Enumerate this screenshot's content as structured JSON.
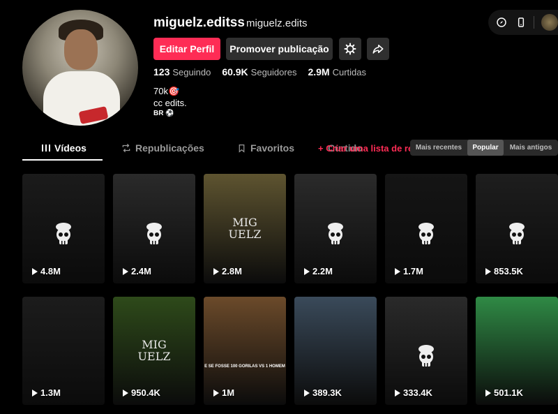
{
  "profile": {
    "username": "miguelz.editss",
    "nickname": "miguelz.edits",
    "edit_label": "Editar Perfil",
    "promote_label": "Promover publicação",
    "stats": [
      {
        "value": "123",
        "label": "Seguindo"
      },
      {
        "value": "60.9K",
        "label": "Seguidores"
      },
      {
        "value": "2.9M",
        "label": "Curtidas"
      }
    ],
    "bio_line1": "70k🎯",
    "bio_line2": "cc edits.",
    "bio_line3": "BR ⚽"
  },
  "tabs": {
    "videos": "Vídeos",
    "reposts": "Republicações",
    "favorites": "Favoritos",
    "liked": "Curtido",
    "create_playlist": "+ Criar uma lista de reprodução"
  },
  "sort": {
    "recent": "Mais recentes",
    "popular": "Popular",
    "oldest": "Mais antigos"
  },
  "videos": [
    {
      "views": "4.8M",
      "bg": "#1b1b1b"
    },
    {
      "views": "2.4M",
      "bg": "#2a2a2a"
    },
    {
      "views": "2.8M",
      "bg": "#5e5430",
      "text": "MIG\nUELZ"
    },
    {
      "views": "2.2M",
      "bg": "#2b2b2b"
    },
    {
      "views": "1.7M",
      "bg": "#151515"
    },
    {
      "views": "853.5K",
      "bg": "#1e1e1e"
    },
    {
      "views": "1.3M",
      "bg": "#1c1c1c"
    },
    {
      "views": "950.4K",
      "bg": "#2e4a1a",
      "text": "MIG\nUELZ"
    },
    {
      "views": "1M",
      "bg": "#6b4a2a",
      "caption": "E SE FOSSE 100 GORILAS VS 1 HOMEM"
    },
    {
      "views": "389.3K",
      "bg": "#3a4a5a"
    },
    {
      "views": "333.4K",
      "bg": "#2a2a2a"
    },
    {
      "views": "501.1K",
      "bg": "#2f8a45"
    }
  ],
  "colors": {
    "accent": "#fe2c55",
    "button_dark": "#2f2f2f"
  }
}
